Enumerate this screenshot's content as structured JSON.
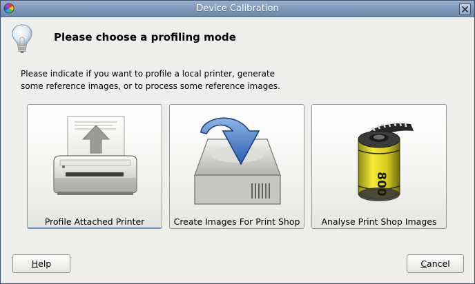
{
  "window": {
    "title": "Device Calibration",
    "app_icon": "color-wheel-icon",
    "close_icon": "close-icon"
  },
  "header": {
    "icon": "lightbulb-icon",
    "heading": "Please choose a profiling mode"
  },
  "description": {
    "line1": "Please indicate if you want to profile a local printer, generate",
    "line2": "some reference images, or to process some reference images."
  },
  "modes": [
    {
      "label": "Profile Attached Printer",
      "icon": "printer-icon",
      "focused": true
    },
    {
      "label": "Create Images For Print Shop",
      "icon": "drive-save-icon",
      "focused": false
    },
    {
      "label": "Analyse Print Shop Images",
      "icon": "film-roll-icon",
      "focused": false
    }
  ],
  "buttons": {
    "help": {
      "mnemonic": "H",
      "rest": "elp"
    },
    "cancel": {
      "mnemonic": "C",
      "rest": "ancel"
    }
  },
  "film_label": "800"
}
